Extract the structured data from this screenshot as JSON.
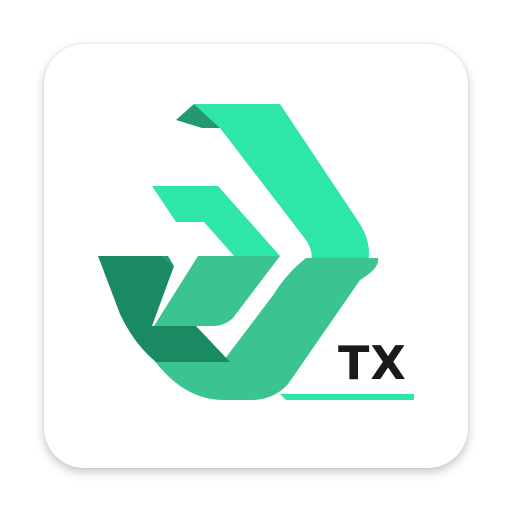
{
  "app_icon": {
    "badge_text": "TX",
    "icon_name": "chevron-arrow-logo-icon",
    "colors": {
      "light_green": "#2ee6a8",
      "mid_green": "#3cc490",
      "dark_green": "#229970",
      "darker_green": "#1a8a62",
      "text": "#1a1a1a",
      "tile_background": "#ffffff"
    }
  }
}
